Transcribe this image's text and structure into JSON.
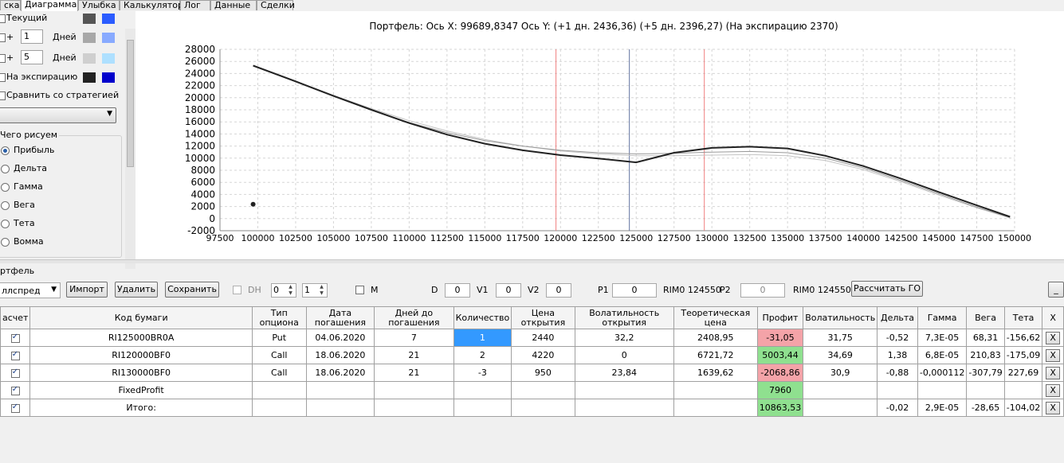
{
  "tabs": [
    {
      "label": "ска"
    },
    {
      "label": "Диаграмма"
    },
    {
      "label": "Улыбка"
    },
    {
      "label": "Калькулятор"
    },
    {
      "label": "Лог"
    },
    {
      "label": "Данные"
    },
    {
      "label": "Сделки"
    }
  ],
  "left": {
    "current_label": "Текущий",
    "plus": "+",
    "days1": "1",
    "days2": "5",
    "days_label": "Дней",
    "expiry_label": "На экспирацию",
    "compare_label": "Сравнить со стратегией",
    "what_draw_label": "Чего рисуем",
    "options": [
      "Прибыль",
      "Дельта",
      "Гамма",
      "Вега",
      "Тета",
      "Вомма"
    ],
    "selected_option": "Прибыль",
    "colors": {
      "current": [
        "#555555",
        "#2b5cff"
      ],
      "plus1": [
        "#a8a8a8",
        "#88aaff"
      ],
      "plus5": [
        "#cfcfcf",
        "#aee0ff"
      ],
      "expiry": [
        "#222222",
        "#0000cc"
      ]
    }
  },
  "chart": {
    "header": "Портфель: Ось X: 99689,8347 Ось Y:  (+1 дн. 2436,36)  (+5 дн. 2396,27)  (На экспирацию 2370)"
  },
  "chart_data": {
    "type": "line",
    "xlim": [
      97500,
      150000
    ],
    "ylim": [
      -2000,
      28000
    ],
    "x_ticks": [
      "97500",
      "100000",
      "102500",
      "105000",
      "107500",
      "110000",
      "112500",
      "115000",
      "117500",
      "120000",
      "122500",
      "125000",
      "127500",
      "130000",
      "132500",
      "135000",
      "137500",
      "140000",
      "142500",
      "145000",
      "147500",
      "150000"
    ],
    "y_ticks": [
      "28000",
      "26000",
      "24000",
      "22000",
      "20000",
      "18000",
      "16000",
      "14000",
      "12000",
      "10000",
      "8000",
      "6000",
      "4000",
      "2000",
      "0",
      "-2000"
    ],
    "grid": true,
    "vlines": [
      {
        "x": 119700,
        "color": "#f08080"
      },
      {
        "x": 124550,
        "color": "#6070a0"
      },
      {
        "x": 129500,
        "color": "#f08080"
      }
    ],
    "point": {
      "x": 99690,
      "y": 2370
    },
    "series": [
      {
        "color": "#222222",
        "x": [
          99690,
          102500,
          105000,
          107500,
          110000,
          112500,
          115000,
          117500,
          120000,
          122500,
          125000,
          127500,
          130000,
          132500,
          135000,
          137500,
          140000,
          142500,
          145000,
          147500,
          149700
        ],
        "y": [
          25300,
          22700,
          20300,
          18000,
          15800,
          13900,
          12400,
          11300,
          10500,
          9950,
          9300,
          10900,
          11700,
          11900,
          11600,
          10400,
          8700,
          6600,
          4400,
          2200,
          300
        ]
      },
      {
        "color": "#9a9a9a",
        "x": [
          99690,
          102500,
          105000,
          107500,
          110000,
          112500,
          115000,
          117500,
          120000,
          122500,
          125000,
          127500,
          130000,
          132500,
          135000,
          137500,
          140000,
          142500,
          145000,
          147500,
          149700
        ],
        "y": [
          25300,
          22600,
          20200,
          17950,
          15900,
          14200,
          12900,
          12000,
          11300,
          10900,
          10700,
          10800,
          11000,
          11100,
          10900,
          10000,
          8400,
          6300,
          4100,
          1900,
          200
        ]
      },
      {
        "color": "#c4c4c4",
        "x": [
          99690,
          102500,
          105000,
          107500,
          110000,
          112500,
          115000,
          117500,
          120000,
          122500,
          125000,
          127500,
          130000,
          132500,
          135000,
          137500,
          140000,
          142500,
          145000,
          147500,
          149700
        ],
        "y": [
          25300,
          22700,
          20400,
          18200,
          16200,
          14500,
          13100,
          12000,
          11200,
          10700,
          10400,
          10400,
          10500,
          10600,
          10400,
          9600,
          8100,
          6100,
          3900,
          1800,
          100
        ]
      }
    ]
  },
  "portfolio": {
    "group_label": "ртфель",
    "strategy_value": "ллспред",
    "import_btn": "Импорт",
    "delete_btn": "Удалить",
    "save_btn": "Сохранить",
    "dh_label": "DH",
    "spin_a": "0",
    "spin_b": "1",
    "m_label": "M",
    "d_label": "D",
    "d_value": "0",
    "v1_label": "V1",
    "v1_value": "0",
    "v2_label": "V2",
    "v2_value": "0",
    "p1_label": "P1",
    "p1_value": "0",
    "rim1": "RIM0 124550",
    "p2_label": "P2",
    "p2_value": "0",
    "rim2": "RIM0 124550",
    "calc_btn": "Рассчитать ГО",
    "min_btn": "_"
  },
  "grid": {
    "headers": [
      "асчет",
      "Код бумаги",
      "Тип опциона",
      "Дата погашения",
      "Дней до погашения",
      "Количество",
      "Цена открытия",
      "Волатильность открытия",
      "Теоретическая цена",
      "Профит",
      "Волатильность",
      "Дельта",
      "Гамма",
      "Вега",
      "Тета",
      "X"
    ],
    "rows": [
      {
        "code": "RI125000BR0A",
        "type": "Put",
        "date": "04.06.2020",
        "days": "7",
        "qty": "1",
        "price": "2440",
        "vol_open": "32,2",
        "theo": "2408,95",
        "profit": "-31,05",
        "vol": "31,75",
        "delta": "-0,52",
        "gamma": "7,3E-05",
        "vega": "68,31",
        "theta": "-156,62",
        "x": "X"
      },
      {
        "code": "RI120000BF0",
        "type": "Call",
        "date": "18.06.2020",
        "days": "21",
        "qty": "2",
        "price": "4220",
        "vol_open": "0",
        "theo": "6721,72",
        "profit": "5003,44",
        "vol": "34,69",
        "delta": "1,38",
        "gamma": "6,8E-05",
        "vega": "210,83",
        "theta": "-175,09",
        "x": "X"
      },
      {
        "code": "RI130000BF0",
        "type": "Call",
        "date": "18.06.2020",
        "days": "21",
        "qty": "-3",
        "price": "950",
        "vol_open": "23,84",
        "theo": "1639,62",
        "profit": "-2068,86",
        "vol": "30,9",
        "delta": "-0,88",
        "gamma": "-0,000112",
        "vega": "-307,79",
        "theta": "227,69",
        "x": "X"
      },
      {
        "code": "FixedProfit",
        "type": "",
        "date": "",
        "days": "",
        "qty": "",
        "price": "",
        "vol_open": "",
        "theo": "",
        "profit": "7960",
        "vol": "",
        "delta": "",
        "gamma": "",
        "vega": "",
        "theta": "",
        "x": "X"
      },
      {
        "code": "Итого:",
        "type": "",
        "date": "",
        "days": "",
        "qty": "",
        "price": "",
        "vol_open": "",
        "theo": "",
        "profit": "10863,53",
        "vol": "",
        "delta": "-0,02",
        "gamma": "2,9E-05",
        "vega": "-28,65",
        "theta": "-104,02",
        "x": "X"
      }
    ]
  }
}
